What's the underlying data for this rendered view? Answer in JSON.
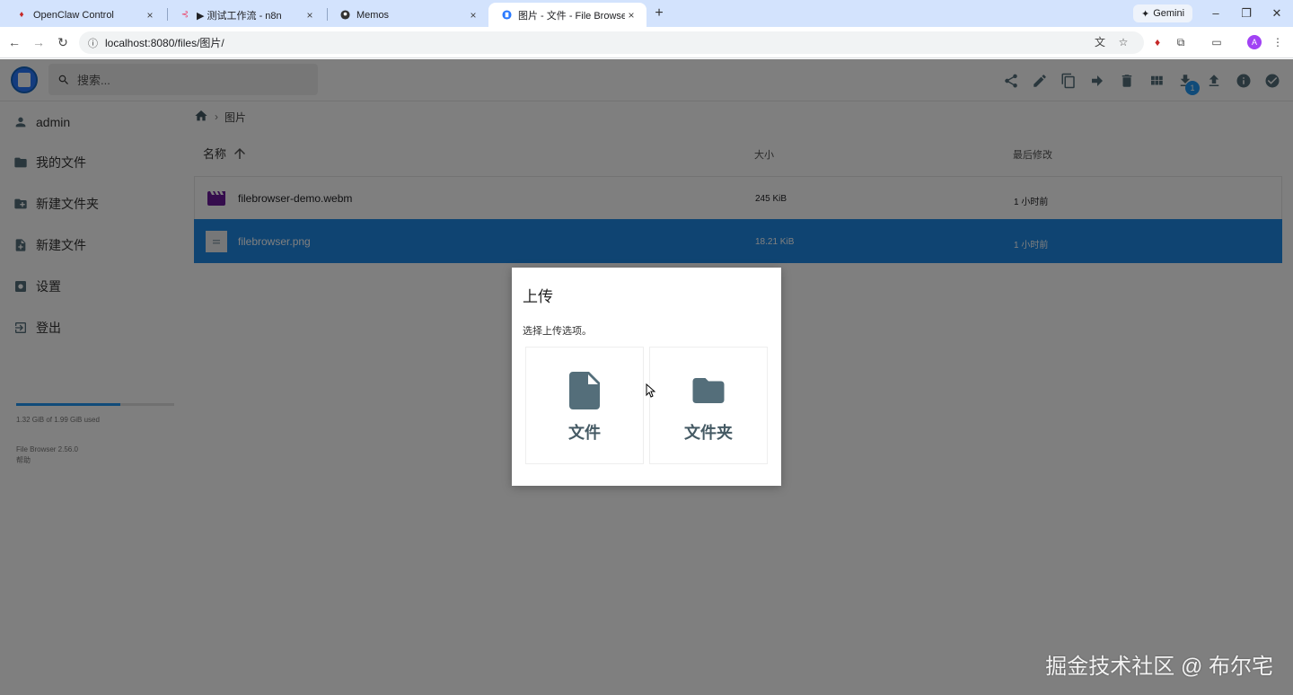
{
  "browser": {
    "tabs": [
      {
        "title": "OpenClaw Control",
        "icon": "openclaw-icon"
      },
      {
        "title": "▶ 测试工作流 - n8n",
        "icon": "n8n-icon"
      },
      {
        "title": "Memos",
        "icon": "memos-icon"
      },
      {
        "title": "图片 - 文件 - File Browser",
        "icon": "filebrowser-icon",
        "active": true
      }
    ],
    "gemini_label": "Gemini",
    "url": "localhost:8080/files/图片/"
  },
  "app": {
    "search_placeholder": "搜索...",
    "download_badge": "1",
    "sidebar": {
      "user": "admin",
      "items": [
        "我的文件",
        "新建文件夹",
        "新建文件",
        "设置",
        "登出"
      ],
      "usage_text": "1.32 GiB of 1.99 GiB used",
      "usage_fraction": 0.66,
      "version": "File Browser 2.56.0",
      "help": "帮助"
    },
    "breadcrumb": {
      "folder": "图片"
    },
    "columns": {
      "name": "名称",
      "size": "大小",
      "modified": "最后修改"
    },
    "files": [
      {
        "name": "filebrowser-demo.webm",
        "size": "245 KiB",
        "modified": "1 小时前",
        "selected": false,
        "type": "video"
      },
      {
        "name": "filebrowser.png",
        "size": "18.21 KiB",
        "modified": "1 小时前",
        "selected": true,
        "type": "image"
      }
    ]
  },
  "dialog": {
    "title": "上传",
    "text": "选择上传选项。",
    "options": [
      {
        "label": "文件",
        "icon": "file-icon"
      },
      {
        "label": "文件夹",
        "icon": "folder-icon"
      }
    ]
  },
  "watermark": "掘金技术社区 @ 布尔宅",
  "colors": {
    "accent": "#1e88e5",
    "icon": "#546e7a",
    "tabbar": "#d3e3fd"
  }
}
